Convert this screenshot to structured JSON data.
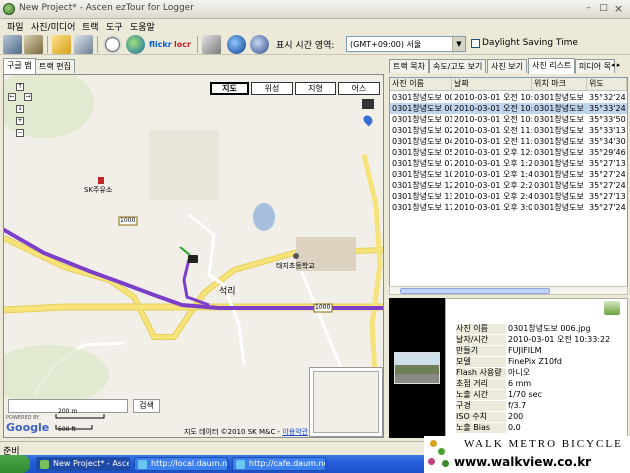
{
  "window": {
    "title": "New Project* - Ascen ezTour for Logger",
    "minimize": "–",
    "maximize": "□",
    "close": "×"
  },
  "menu": [
    "파일",
    "사진/미디어",
    "트랙",
    "도구",
    "도움말"
  ],
  "toolbar": {
    "timezone_label": "표시 시간 영역:",
    "timezone_value": "(GMT+09:00) 서울",
    "dst_label": "Daylight Saving Time",
    "flickr_label": "flickr",
    "locr_label": "locr",
    "icons": [
      "import-gps-icon",
      "device-icon",
      "open-folder-icon",
      "save-icon",
      "clock-icon",
      "globe-icon",
      "flickr-icon",
      "locr-icon",
      "print-icon",
      "google-earth-icon",
      "export-icon"
    ]
  },
  "left_tabs": [
    "구글 맵",
    "트랙 편집"
  ],
  "map": {
    "types": [
      "지도",
      "위성",
      "지형",
      "어스"
    ],
    "active_type": "지도",
    "labels": {
      "gas_station": "SK주유소",
      "school": "태지초등학교",
      "village": "석리",
      "road_1": "1000",
      "road_2": "1000"
    },
    "search_button": "검색",
    "scale": [
      "200 m",
      "500 ft"
    ],
    "powered_by": "POWERED BY",
    "google_logo": "Google",
    "copyright": "지도 데이터 ©2010 SK M&C - ",
    "terms_link": "이용약관",
    "nav": {
      "up": "↑",
      "left": "←",
      "right": "→",
      "down": "↓",
      "zoom_in": "+",
      "zoom_out": "−"
    }
  },
  "right_tabs": [
    "트랙 목차",
    "속도/고도 보기",
    "사진 보기",
    "사진 리스트",
    "미디어 목"
  ],
  "right_tab_arrows": "◂ ▸",
  "active_right_tab": "사진 리스트",
  "photo_table": {
    "columns": [
      "사진 이름",
      "날짜",
      "위치 마크",
      "위도"
    ],
    "rows": [
      [
        "0301창녕도보 00",
        "2010-03-01 오전 10:2",
        "0301창녕도보",
        "35°32'24"
      ],
      [
        "0301창녕도보 00",
        "2010-03-01 오전 10:3",
        "0301창녕도보",
        "35°33'24"
      ],
      [
        "0301창녕도보 01",
        "2010-03-01 오전 10:5",
        "0301창녕도보",
        "35°33'50"
      ],
      [
        "0301창녕도보 02",
        "2010-03-01 오전 11:3",
        "0301창녕도보",
        "35°33'13"
      ],
      [
        "0301창녕도보 04",
        "2010-03-01 오전 11:5",
        "0301창녕도보",
        "35°34'30"
      ],
      [
        "0301창녕도보 05",
        "2010-03-01 오후 12:2",
        "0301창녕도보",
        "35°29'46"
      ],
      [
        "0301창녕도보 07",
        "2010-03-01 오후 1:21",
        "0301창녕도보",
        "35°27'13"
      ],
      [
        "0301창녕도보 10",
        "2010-03-01 오후 1:46",
        "0301창녕도보",
        "35°27'24"
      ],
      [
        "0301창녕도보 12",
        "2010-03-01 오후 2:20",
        "0301창녕도보",
        "35°27'24"
      ],
      [
        "0301창녕도보 13",
        "2010-03-01 오후 2:44",
        "0301창녕도보",
        "35°27'13"
      ],
      [
        "0301창녕도보 17",
        "2010-03-01 오후 3:07",
        "0301창녕도보",
        "35°27'24"
      ]
    ],
    "selected_row": 1
  },
  "photo_info": {
    "rows": [
      [
        "사진 이름",
        "0301창녕도보 006.jpg"
      ],
      [
        "날자/시간",
        "2010-03-01 오전 10:33:22"
      ],
      [
        "만들기",
        "FUJIFILM"
      ],
      [
        "모델",
        "FinePix Z10fd"
      ],
      [
        "Flash 사용량",
        "아니오"
      ],
      [
        "초점 거리",
        "6 mm"
      ],
      [
        "노출 시간",
        "1/70 sec"
      ],
      [
        "구경",
        "f/3.7"
      ],
      [
        "ISO 수치",
        "200"
      ],
      [
        "노출 Bias",
        "0.0"
      ]
    ]
  },
  "status": {
    "text": "준비"
  },
  "taskbar": {
    "tasks": [
      "New Project* - Ascen ...",
      "http://local.daum.net -...",
      "http://cafe.daum.net -..."
    ]
  },
  "watermark": {
    "line1": "WALK METRO BICYCLE",
    "line2": "www.walkview.co.kr"
  },
  "colors": {
    "track": "#7b3fc9",
    "road_yellow": "#f6e37a",
    "selection": "#c0d4ec",
    "taskbar": "#245edb"
  }
}
